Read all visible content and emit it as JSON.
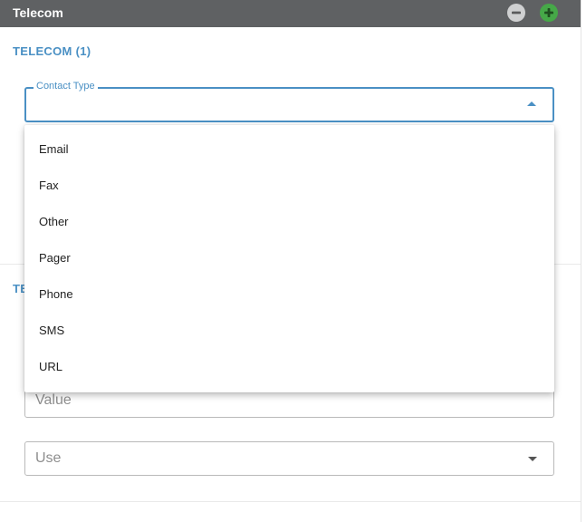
{
  "panel": {
    "title": "Telecom",
    "remove_icon": "minus-circle-icon",
    "add_icon": "plus-circle-icon"
  },
  "section1": {
    "title": "TELECOM (1)"
  },
  "section2": {
    "title_partial": "TE"
  },
  "contact_type": {
    "label": "Contact Type",
    "value": "",
    "options": [
      "Email",
      "Fax",
      "Other",
      "Pager",
      "Phone",
      "SMS",
      "URL"
    ]
  },
  "value_field": {
    "placeholder": "Value"
  },
  "use_field": {
    "placeholder": "Use"
  },
  "colors": {
    "header_bg": "#5f6163",
    "accent": "#4a90c4",
    "add_green": "#46a848"
  }
}
